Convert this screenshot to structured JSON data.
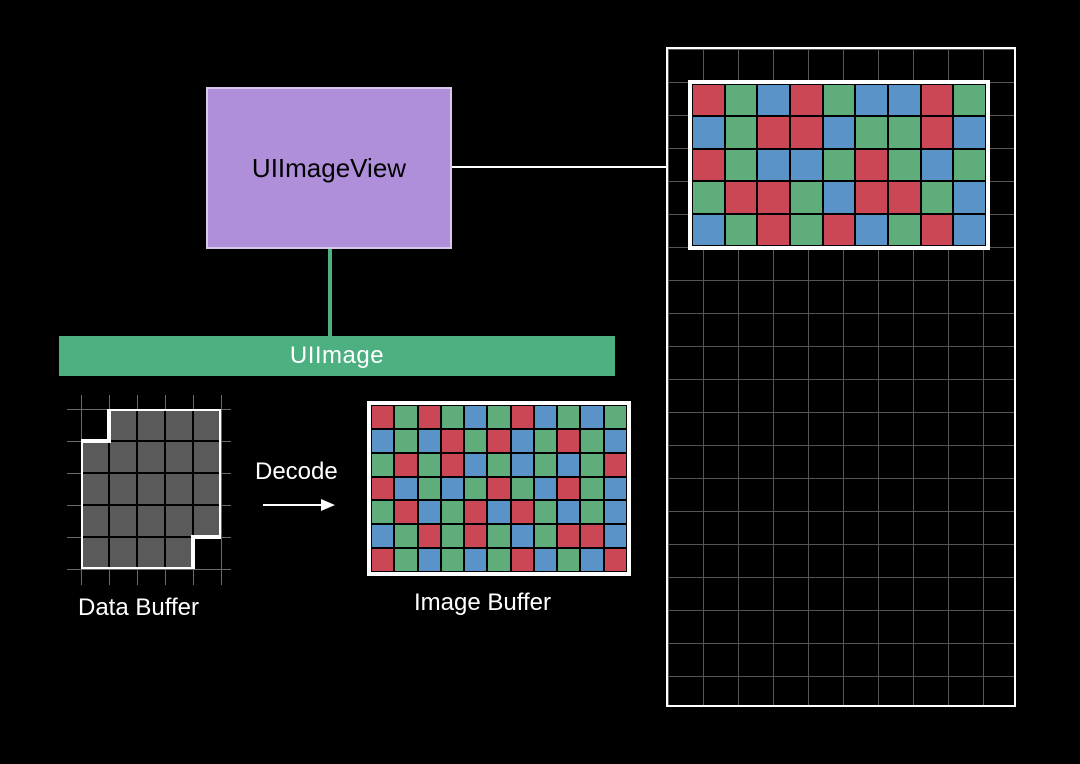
{
  "boxes": {
    "uiimageview": "UIImageView",
    "uiimage": "UIImage"
  },
  "labels": {
    "decode": "Decode",
    "data_buffer": "Data Buffer",
    "image_buffer": "Image Buffer"
  },
  "colors": {
    "purple": "#AF8FD9",
    "green_bar": "#4CB081",
    "pixel_red": "#CC4755",
    "pixel_green": "#5EAD7B",
    "pixel_blue": "#5A93C7",
    "data_cell": "#5A5A5A",
    "grid_line": "#555555"
  },
  "pixel_small": [
    "rgbrgbbrg",
    "bgrrbggrb",
    "rgbbgrgbg",
    "grrgbrrgb",
    "bgrgrbgrb"
  ],
  "pixel_large": [
    "rgrgbgrbgbg",
    "bgbrgrbgrgb",
    "grgrbgbgbgr",
    "rbgbgrgbrgb",
    "grbgrbrgbgb",
    "bgrgrgbgrrb",
    "rgbgbgrbgbr"
  ],
  "data_buffer_shape": [
    "01111",
    "11111",
    "11111",
    "11111",
    "11110"
  ]
}
